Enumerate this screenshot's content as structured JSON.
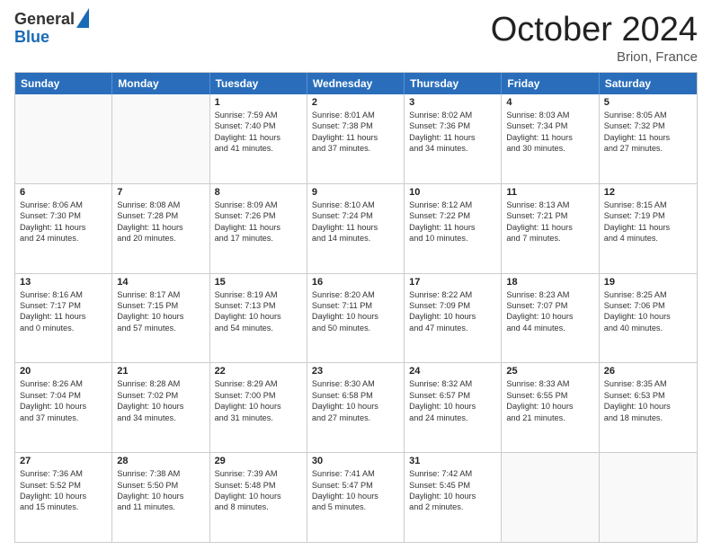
{
  "header": {
    "logo_general": "General",
    "logo_blue": "Blue",
    "title": "October 2024",
    "location": "Brion, France"
  },
  "weekdays": [
    "Sunday",
    "Monday",
    "Tuesday",
    "Wednesday",
    "Thursday",
    "Friday",
    "Saturday"
  ],
  "rows": [
    [
      {
        "day": "",
        "lines": [],
        "empty": true
      },
      {
        "day": "",
        "lines": [],
        "empty": true
      },
      {
        "day": "1",
        "lines": [
          "Sunrise: 7:59 AM",
          "Sunset: 7:40 PM",
          "Daylight: 11 hours",
          "and 41 minutes."
        ]
      },
      {
        "day": "2",
        "lines": [
          "Sunrise: 8:01 AM",
          "Sunset: 7:38 PM",
          "Daylight: 11 hours",
          "and 37 minutes."
        ]
      },
      {
        "day": "3",
        "lines": [
          "Sunrise: 8:02 AM",
          "Sunset: 7:36 PM",
          "Daylight: 11 hours",
          "and 34 minutes."
        ]
      },
      {
        "day": "4",
        "lines": [
          "Sunrise: 8:03 AM",
          "Sunset: 7:34 PM",
          "Daylight: 11 hours",
          "and 30 minutes."
        ]
      },
      {
        "day": "5",
        "lines": [
          "Sunrise: 8:05 AM",
          "Sunset: 7:32 PM",
          "Daylight: 11 hours",
          "and 27 minutes."
        ]
      }
    ],
    [
      {
        "day": "6",
        "lines": [
          "Sunrise: 8:06 AM",
          "Sunset: 7:30 PM",
          "Daylight: 11 hours",
          "and 24 minutes."
        ]
      },
      {
        "day": "7",
        "lines": [
          "Sunrise: 8:08 AM",
          "Sunset: 7:28 PM",
          "Daylight: 11 hours",
          "and 20 minutes."
        ]
      },
      {
        "day": "8",
        "lines": [
          "Sunrise: 8:09 AM",
          "Sunset: 7:26 PM",
          "Daylight: 11 hours",
          "and 17 minutes."
        ]
      },
      {
        "day": "9",
        "lines": [
          "Sunrise: 8:10 AM",
          "Sunset: 7:24 PM",
          "Daylight: 11 hours",
          "and 14 minutes."
        ]
      },
      {
        "day": "10",
        "lines": [
          "Sunrise: 8:12 AM",
          "Sunset: 7:22 PM",
          "Daylight: 11 hours",
          "and 10 minutes."
        ]
      },
      {
        "day": "11",
        "lines": [
          "Sunrise: 8:13 AM",
          "Sunset: 7:21 PM",
          "Daylight: 11 hours",
          "and 7 minutes."
        ]
      },
      {
        "day": "12",
        "lines": [
          "Sunrise: 8:15 AM",
          "Sunset: 7:19 PM",
          "Daylight: 11 hours",
          "and 4 minutes."
        ]
      }
    ],
    [
      {
        "day": "13",
        "lines": [
          "Sunrise: 8:16 AM",
          "Sunset: 7:17 PM",
          "Daylight: 11 hours",
          "and 0 minutes."
        ]
      },
      {
        "day": "14",
        "lines": [
          "Sunrise: 8:17 AM",
          "Sunset: 7:15 PM",
          "Daylight: 10 hours",
          "and 57 minutes."
        ]
      },
      {
        "day": "15",
        "lines": [
          "Sunrise: 8:19 AM",
          "Sunset: 7:13 PM",
          "Daylight: 10 hours",
          "and 54 minutes."
        ]
      },
      {
        "day": "16",
        "lines": [
          "Sunrise: 8:20 AM",
          "Sunset: 7:11 PM",
          "Daylight: 10 hours",
          "and 50 minutes."
        ]
      },
      {
        "day": "17",
        "lines": [
          "Sunrise: 8:22 AM",
          "Sunset: 7:09 PM",
          "Daylight: 10 hours",
          "and 47 minutes."
        ]
      },
      {
        "day": "18",
        "lines": [
          "Sunrise: 8:23 AM",
          "Sunset: 7:07 PM",
          "Daylight: 10 hours",
          "and 44 minutes."
        ]
      },
      {
        "day": "19",
        "lines": [
          "Sunrise: 8:25 AM",
          "Sunset: 7:06 PM",
          "Daylight: 10 hours",
          "and 40 minutes."
        ]
      }
    ],
    [
      {
        "day": "20",
        "lines": [
          "Sunrise: 8:26 AM",
          "Sunset: 7:04 PM",
          "Daylight: 10 hours",
          "and 37 minutes."
        ]
      },
      {
        "day": "21",
        "lines": [
          "Sunrise: 8:28 AM",
          "Sunset: 7:02 PM",
          "Daylight: 10 hours",
          "and 34 minutes."
        ]
      },
      {
        "day": "22",
        "lines": [
          "Sunrise: 8:29 AM",
          "Sunset: 7:00 PM",
          "Daylight: 10 hours",
          "and 31 minutes."
        ]
      },
      {
        "day": "23",
        "lines": [
          "Sunrise: 8:30 AM",
          "Sunset: 6:58 PM",
          "Daylight: 10 hours",
          "and 27 minutes."
        ]
      },
      {
        "day": "24",
        "lines": [
          "Sunrise: 8:32 AM",
          "Sunset: 6:57 PM",
          "Daylight: 10 hours",
          "and 24 minutes."
        ]
      },
      {
        "day": "25",
        "lines": [
          "Sunrise: 8:33 AM",
          "Sunset: 6:55 PM",
          "Daylight: 10 hours",
          "and 21 minutes."
        ]
      },
      {
        "day": "26",
        "lines": [
          "Sunrise: 8:35 AM",
          "Sunset: 6:53 PM",
          "Daylight: 10 hours",
          "and 18 minutes."
        ]
      }
    ],
    [
      {
        "day": "27",
        "lines": [
          "Sunrise: 7:36 AM",
          "Sunset: 5:52 PM",
          "Daylight: 10 hours",
          "and 15 minutes."
        ]
      },
      {
        "day": "28",
        "lines": [
          "Sunrise: 7:38 AM",
          "Sunset: 5:50 PM",
          "Daylight: 10 hours",
          "and 11 minutes."
        ]
      },
      {
        "day": "29",
        "lines": [
          "Sunrise: 7:39 AM",
          "Sunset: 5:48 PM",
          "Daylight: 10 hours",
          "and 8 minutes."
        ]
      },
      {
        "day": "30",
        "lines": [
          "Sunrise: 7:41 AM",
          "Sunset: 5:47 PM",
          "Daylight: 10 hours",
          "and 5 minutes."
        ]
      },
      {
        "day": "31",
        "lines": [
          "Sunrise: 7:42 AM",
          "Sunset: 5:45 PM",
          "Daylight: 10 hours",
          "and 2 minutes."
        ]
      },
      {
        "day": "",
        "lines": [],
        "empty": true
      },
      {
        "day": "",
        "lines": [],
        "empty": true
      }
    ]
  ]
}
